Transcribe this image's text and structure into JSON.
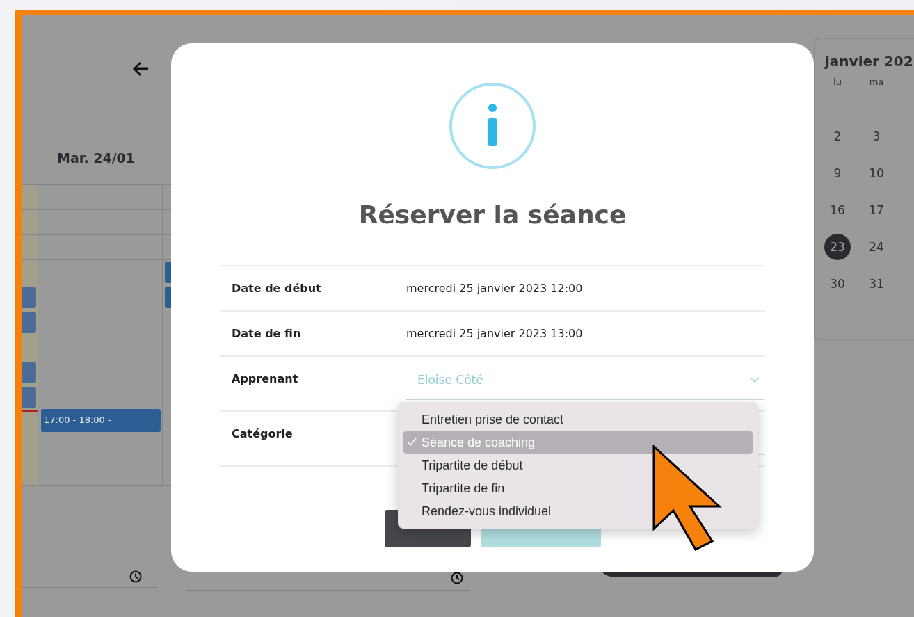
{
  "background": {
    "day_header": "Mar. 24/01",
    "events": [
      {
        "label": "17:00 - 18:00 -"
      }
    ],
    "mini_calendar": {
      "month": "janvier 202",
      "weekdays": [
        "lu",
        "ma"
      ],
      "weeks": [
        [
          {
            "day": "2",
            "selected": false
          },
          {
            "day": "3",
            "selected": false
          }
        ],
        [
          {
            "day": "9",
            "selected": false
          },
          {
            "day": "10",
            "selected": false
          }
        ],
        [
          {
            "day": "16",
            "selected": false
          },
          {
            "day": "17",
            "selected": false
          }
        ],
        [
          {
            "day": "23",
            "selected": true
          },
          {
            "day": "24",
            "selected": false
          }
        ],
        [
          {
            "day": "30",
            "selected": false
          },
          {
            "day": "31",
            "selected": false
          }
        ]
      ]
    }
  },
  "dialog": {
    "title": "Réserver la séance",
    "rows": [
      {
        "kind": "text",
        "label": "Date de début",
        "value": "mercredi 25 janvier 2023 12:00"
      },
      {
        "kind": "text",
        "label": "Date de fin",
        "value": "mercredi 25 janvier 2023 13:00"
      },
      {
        "kind": "select",
        "label": "Apprenant",
        "value": "Eloise Côté"
      },
      {
        "kind": "select",
        "label": "Catégorie"
      }
    ],
    "dropdown": [
      {
        "label": "Entretien prise de contact",
        "selected": false
      },
      {
        "label": "Séance de coaching",
        "selected": true
      },
      {
        "label": "Tripartite de début",
        "selected": false
      },
      {
        "label": "Tripartite de fin",
        "selected": false
      },
      {
        "label": "Rendez-vous individuel",
        "selected": false
      }
    ],
    "buttons": [
      {
        "disabled": false
      },
      {
        "disabled": true
      }
    ]
  }
}
